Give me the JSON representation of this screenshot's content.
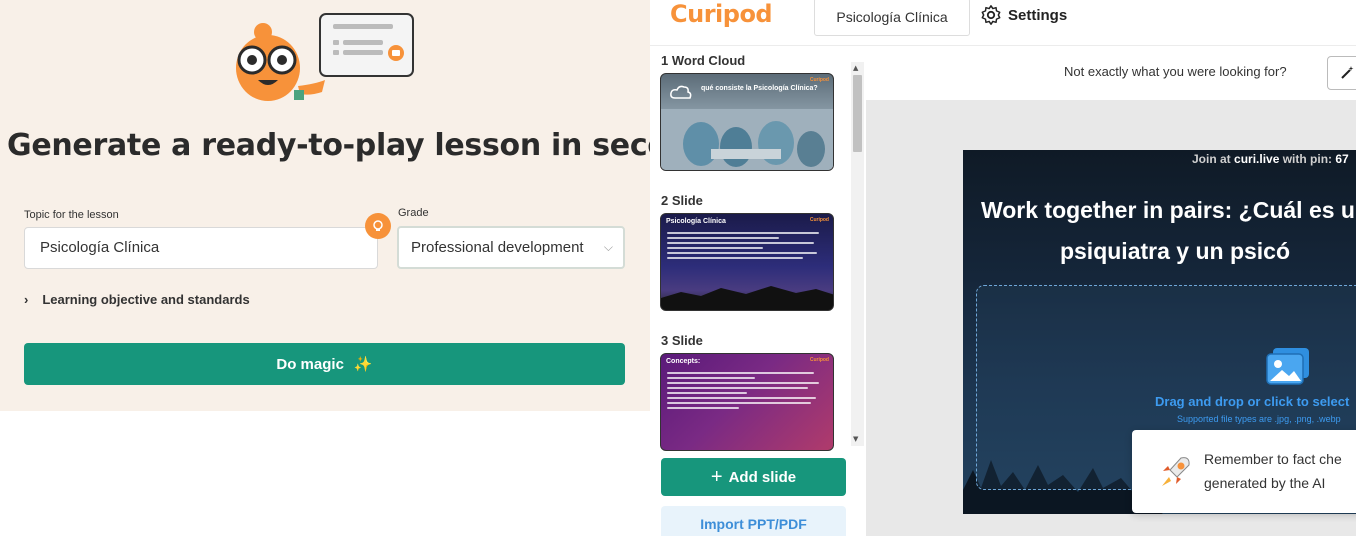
{
  "generator": {
    "title": "Generate a ready-to-play lesson in seconds",
    "topic_label": "Topic for the lesson",
    "topic_value": "Psicología Clínica",
    "grade_label": "Grade",
    "grade_value": "Professional development",
    "objectives_label": "Learning objective and standards",
    "magic_button": "Do magic",
    "magic_emoji": "✨"
  },
  "app": {
    "logo": "Curipod",
    "lesson_title": "Psicología Clínica",
    "settings_label": "Settings",
    "colors": {
      "brand": "#f7923a",
      "primary": "#17967c",
      "link": "#3d9bf0"
    }
  },
  "slides": [
    {
      "label": "1 Word Cloud",
      "title": "qué consiste la Psicología Clínica?",
      "brand": "Curipod"
    },
    {
      "label": "2 Slide",
      "title": "Psicología Clínica",
      "brand": "Curipod"
    },
    {
      "label": "3 Slide",
      "title": "Concepts:",
      "brand": "Curipod"
    }
  ],
  "slide_actions": {
    "add_slide": "Add slide",
    "import": "Import PPT/PDF"
  },
  "editor": {
    "not_exact": "Not exactly what you were looking for?",
    "join_prefix": "Join at ",
    "join_site": "curi.live",
    "join_mid": " with pin: ",
    "join_pin": "67",
    "slide_title": "Work together in pairs: ¿Cuál es un psiquiatra y un psicó",
    "drop_text": "Drag and drop or click to select",
    "drop_sub": "Supported file types are .jpg, .png, .webp"
  },
  "toast": {
    "line1": "Remember to fact che",
    "line2": "generated by the AI"
  }
}
